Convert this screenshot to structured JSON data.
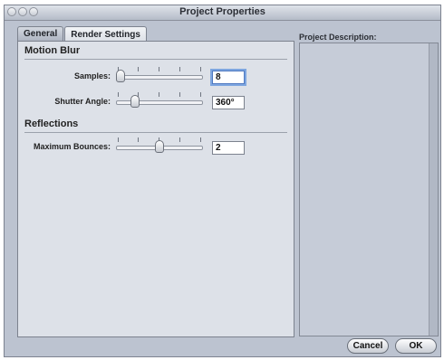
{
  "window": {
    "title": "Project Properties"
  },
  "tabs": [
    {
      "label": "General"
    },
    {
      "label": "Render Settings"
    }
  ],
  "motion_blur": {
    "heading": "Motion Blur",
    "samples": {
      "label": "Samples:",
      "value": "8"
    },
    "shutter_angle": {
      "label": "Shutter Angle:",
      "value": "360°"
    }
  },
  "reflections": {
    "heading": "Reflections",
    "maximum_bounces": {
      "label": "Maximum Bounces:",
      "value": "2"
    }
  },
  "description": {
    "label": "Project Description:",
    "text": ""
  },
  "buttons": {
    "cancel": "Cancel",
    "ok": "OK"
  }
}
